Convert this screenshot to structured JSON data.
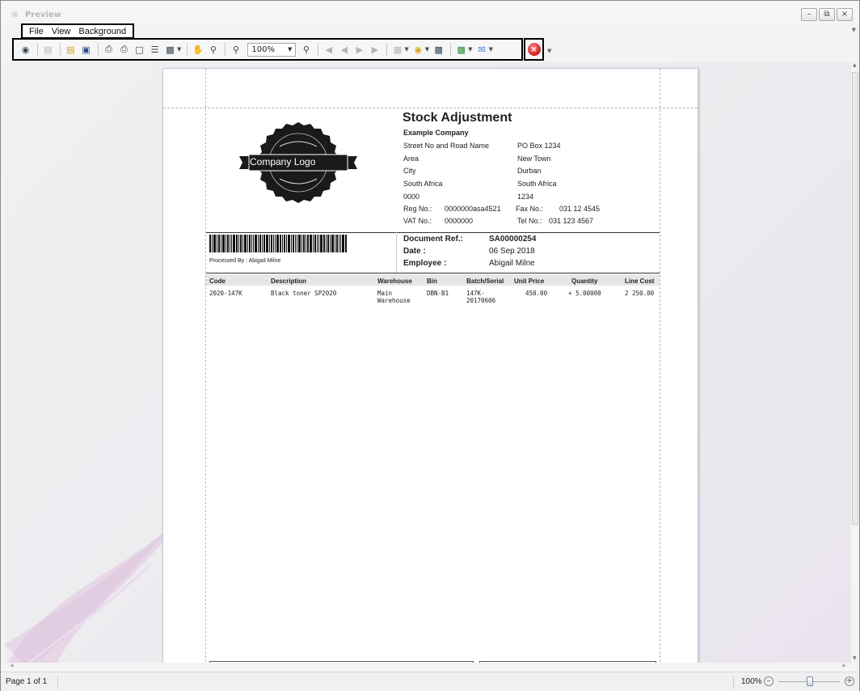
{
  "window": {
    "title": "Preview"
  },
  "menu": {
    "items": [
      "File",
      "View",
      "Background"
    ]
  },
  "toolbar": {
    "zoom_value": "100%"
  },
  "document": {
    "title": "Stock Adjustment",
    "company": "Example Company",
    "logo_text": "Company Logo",
    "address_left": [
      "Street No and Road Name",
      "Area",
      "City",
      "South Africa",
      "0000"
    ],
    "address_right": [
      "PO Box 1234",
      "New Town",
      "Durban",
      "South Africa",
      "1234"
    ],
    "reg_label": "Reg No.:",
    "reg_value": "0000000asa4521",
    "vat_label": "VAT No.:",
    "vat_value": "0000000",
    "fax_label": "Fax No.:",
    "fax_value": "031 12 4545",
    "tel_label": "Tel No.:",
    "tel_value": "031 123 4567",
    "processed_by": "Processed By : Abigail Milne",
    "doc_ref_label": "Document Ref.:",
    "doc_ref_value": "SA00000254",
    "date_label": "Date :",
    "date_value": "06 Sep 2018",
    "employee_label": "Employee :",
    "employee_value": "Abigail Milne",
    "columns": [
      "Code",
      "Description",
      "Warehouse",
      "Bin",
      "Batch/Serial",
      "Unit Price",
      "Quantity",
      "Line Cost"
    ],
    "rows": [
      {
        "code": "2020-147K",
        "description": "Black toner SP2020",
        "warehouse_1": "Main",
        "warehouse_2": "Warehouse",
        "bin": "DBN-B1",
        "batch_1": "147K-",
        "batch_2": "20170606",
        "unit_price": "450.00",
        "quantity": "+ 5.00000",
        "line_cost": "2 250.00"
      }
    ]
  },
  "status": {
    "page_info": "Page 1 of 1",
    "zoom": "100%"
  },
  "colors": {
    "close_button": "#d21a1a",
    "page_border": "#bfc8d8"
  }
}
